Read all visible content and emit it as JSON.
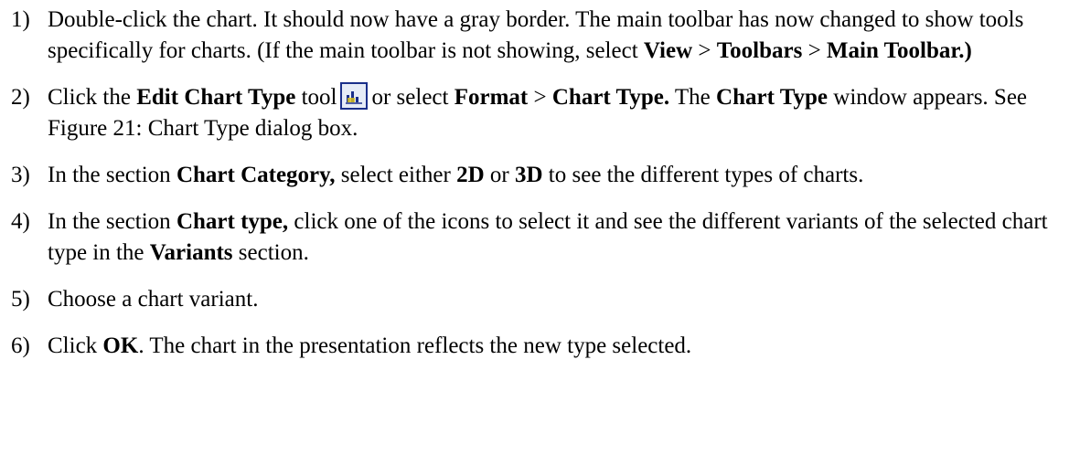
{
  "steps": [
    {
      "num": "1)",
      "parts": [
        {
          "t": "Double-click the chart. It should now have a gray border. The main toolbar has now changed to show tools specifically for charts. (If the main toolbar is not showing, select "
        },
        {
          "t": "View",
          "b": true
        },
        {
          "t": " > "
        },
        {
          "t": "Toolbars",
          "b": true
        },
        {
          "t": " > "
        },
        {
          "t": "Main Toolbar.)",
          "b": true
        }
      ]
    },
    {
      "num": "2)",
      "parts": [
        {
          "t": "Click the "
        },
        {
          "t": "Edit Chart Type",
          "b": true
        },
        {
          "t": " tool"
        },
        {
          "icon": "edit-chart-type-icon"
        },
        {
          "t": "or select "
        },
        {
          "t": "Format",
          "b": true
        },
        {
          "t": " > "
        },
        {
          "t": "Chart Type.",
          "b": true
        },
        {
          "t": " The "
        },
        {
          "t": "Chart Type",
          "b": true
        },
        {
          "t": " window appears. See Figure 21: Chart Type dialog box."
        }
      ]
    },
    {
      "num": "3)",
      "parts": [
        {
          "t": "In the section "
        },
        {
          "t": "Chart Category,",
          "b": true
        },
        {
          "t": " select either "
        },
        {
          "t": "2D",
          "b": true
        },
        {
          "t": " or "
        },
        {
          "t": "3D",
          "b": true
        },
        {
          "t": " to see the different types of charts."
        }
      ]
    },
    {
      "num": "4)",
      "parts": [
        {
          "t": "In the section "
        },
        {
          "t": "Chart type,",
          "b": true
        },
        {
          "t": " click one of the icons to select it and see the different variants of the selected chart type in the "
        },
        {
          "t": "Variants",
          "b": true
        },
        {
          "t": " section."
        }
      ]
    },
    {
      "num": "5)",
      "parts": [
        {
          "t": "Choose a chart variant."
        }
      ]
    },
    {
      "num": "6)",
      "parts": [
        {
          "t": "Click "
        },
        {
          "t": "OK",
          "b": true
        },
        {
          "t": ". The chart in the presentation reflects the new type selected."
        }
      ]
    }
  ]
}
